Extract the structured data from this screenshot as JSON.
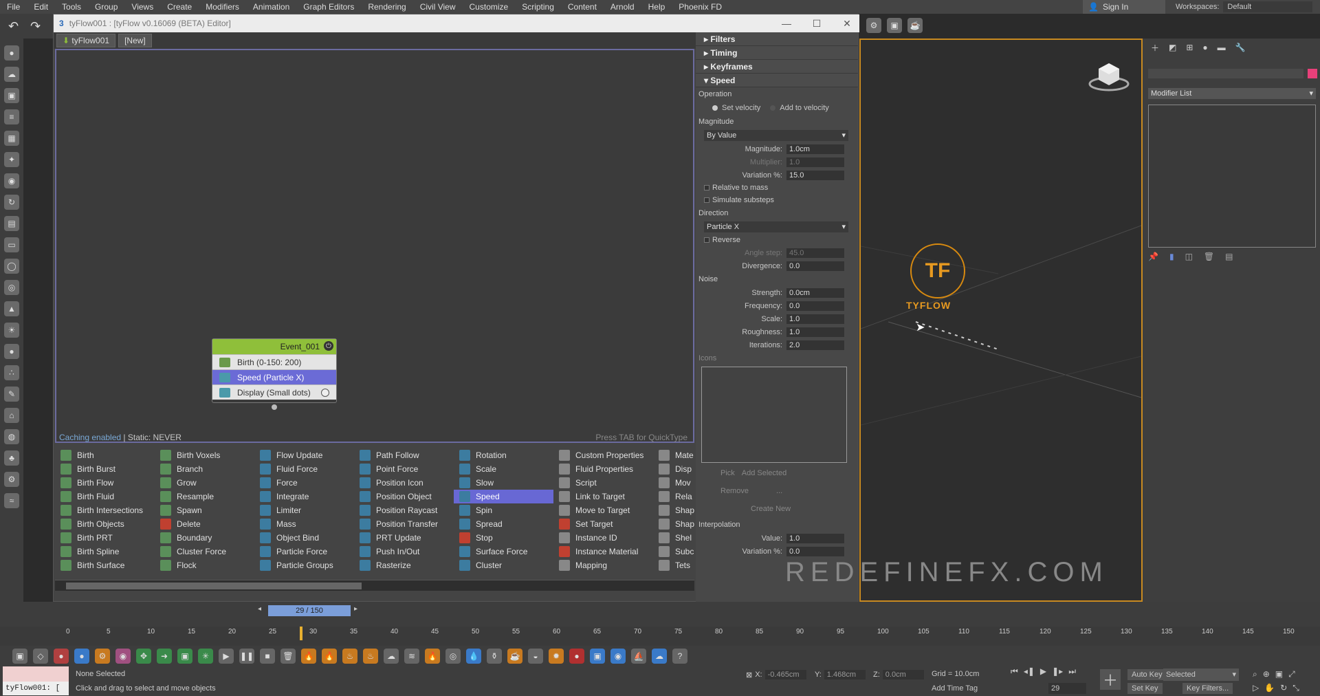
{
  "menubar": {
    "items": [
      "File",
      "Edit",
      "Tools",
      "Group",
      "Views",
      "Create",
      "Modifiers",
      "Animation",
      "Graph Editors",
      "Rendering",
      "Civil View",
      "Customize",
      "Scripting",
      "Content",
      "Arnold",
      "Help",
      "Phoenix FD"
    ],
    "signin": "Sign In",
    "workspace_label": "Workspaces:",
    "workspace_value": "Default"
  },
  "tyflow": {
    "title": "tyFlow001 : [tyFlow v0.16069 (BETA) Editor]",
    "tabs": [
      "tyFlow001",
      "[New]"
    ],
    "cache_on": "Caching enabled",
    "cache_static": " | Static: NEVER",
    "quicktype_hint": "Press TAB for QuickType",
    "event": {
      "name": "Event_001",
      "ops": [
        "Birth (0-150: 200)",
        "Speed (Particle X)",
        "Display (Small dots)"
      ]
    },
    "palette_cols": [
      [
        "Birth",
        "Birth Burst",
        "Birth Flow",
        "Birth Fluid",
        "Birth Intersections",
        "Birth Objects",
        "Birth PRT",
        "Birth Spline",
        "Birth Surface"
      ],
      [
        "Birth Voxels",
        "Branch",
        "Grow",
        "Resample",
        "Spawn",
        "Delete",
        "Boundary",
        "Cluster Force",
        "Flock"
      ],
      [
        "Flow Update",
        "Fluid Force",
        "Force",
        "Integrate",
        "Limiter",
        "Mass",
        "Object Bind",
        "Particle Force",
        "Particle Groups"
      ],
      [
        "Path Follow",
        "Point Force",
        "Position Icon",
        "Position Object",
        "Position Raycast",
        "Position Transfer",
        "PRT Update",
        "Push In/Out",
        "Rasterize"
      ],
      [
        "Rotation",
        "Scale",
        "Slow",
        "Speed",
        "Spin",
        "Spread",
        "Stop",
        "Surface Force",
        "Cluster"
      ],
      [
        "Custom Properties",
        "Fluid Properties",
        "Script",
        "Link to Target",
        "Move to Target",
        "Set Target",
        "Instance ID",
        "Instance Material",
        "Mapping"
      ],
      [
        "Mate",
        "Disp",
        "Mov",
        "Rela",
        "Shap",
        "Shap",
        "Shel",
        "Subc",
        "Tets"
      ]
    ],
    "palette_selected": "Speed"
  },
  "rollout": {
    "sections": [
      "Filters",
      "Timing",
      "Keyframes",
      "Speed"
    ],
    "operation_label": "Operation",
    "radio_set": "Set velocity",
    "radio_add": "Add to velocity",
    "magnitude_label": "Magnitude",
    "magnitude_mode": "By Value",
    "magnitude": {
      "label": "Magnitude:",
      "value": "1.0cm"
    },
    "multiplier": {
      "label": "Multiplier:",
      "value": "1.0"
    },
    "variation": {
      "label": "Variation %:",
      "value": "15.0"
    },
    "relative_mass": "Relative to mass",
    "simulate_substeps": "Simulate substeps",
    "direction_label": "Direction",
    "direction_mode": "Particle X",
    "reverse": "Reverse",
    "angle_step": {
      "label": "Angle step:",
      "value": "45.0"
    },
    "divergence": {
      "label": "Divergence:",
      "value": "0.0"
    },
    "noise_label": "Noise",
    "strength": {
      "label": "Strength:",
      "value": "0.0cm"
    },
    "frequency": {
      "label": "Frequency:",
      "value": "0.0"
    },
    "scale": {
      "label": "Scale:",
      "value": "1.0"
    },
    "roughness": {
      "label": "Roughness:",
      "value": "1.0"
    },
    "iterations": {
      "label": "Iterations:",
      "value": "2.0"
    },
    "icons_label": "Icons",
    "pick": "Pick",
    "add_selected": "Add Selected",
    "remove": "Remove",
    "ellipsis": "...",
    "create_new": "Create New",
    "interpolation_label": "Interpolation",
    "interp_value": {
      "label": "Value:",
      "value": "1.0"
    },
    "interp_variation": {
      "label": "Variation %:",
      "value": "0.0"
    }
  },
  "viewport": {
    "logo_text": "TYFLOW",
    "watermark_url": "REDEFINEFX.COM"
  },
  "command_panel": {
    "modifier_list": "Modifier List"
  },
  "timeline": {
    "slider": "29 / 150",
    "ticks": [
      "0",
      "5",
      "10",
      "15",
      "20",
      "25",
      "30",
      "35",
      "40",
      "45",
      "50",
      "55",
      "60",
      "65",
      "70",
      "75",
      "80",
      "85",
      "90",
      "95",
      "100",
      "105",
      "110",
      "115",
      "120",
      "125",
      "130",
      "135",
      "140",
      "145",
      "150"
    ]
  },
  "status": {
    "script_line": "tyFlow001: [",
    "none_selected": "None Selected",
    "prompt": "Click and drag to select and move objects",
    "x_label": "X:",
    "x_val": "-0.465cm",
    "y_label": "Y:",
    "y_val": "1.468cm",
    "z_label": "Z:",
    "z_val": "0.0cm",
    "grid": "Grid = 10.0cm",
    "add_time_tag": "Add Time Tag",
    "auto_key": "Auto Key",
    "set_key": "Set Key",
    "selected": "Selected",
    "key_filters": "Key Filters...",
    "frame": "29"
  }
}
